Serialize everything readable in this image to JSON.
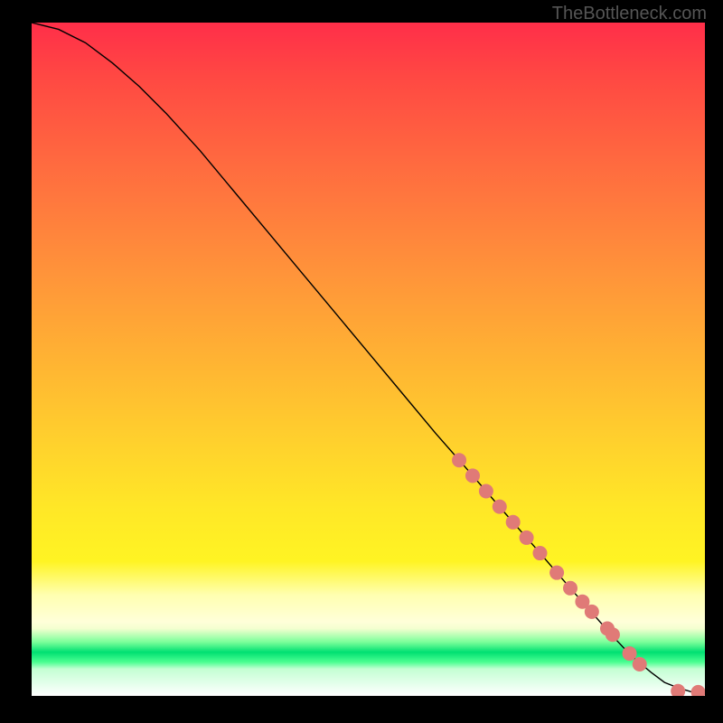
{
  "watermark": "TheBottleneck.com",
  "chart_data": {
    "type": "line",
    "title": "",
    "xlabel": "",
    "ylabel": "",
    "xlim": [
      0,
      100
    ],
    "ylim": [
      0,
      100
    ],
    "curve": {
      "name": "curve",
      "x": [
        0,
        4,
        8,
        12,
        16,
        20,
        25,
        30,
        35,
        40,
        45,
        50,
        55,
        60,
        65,
        70,
        75,
        80,
        83,
        86,
        89,
        92,
        94,
        96,
        98,
        99.2
      ],
      "y": [
        100,
        99,
        97,
        94,
        90.5,
        86.5,
        81,
        75,
        69,
        63,
        57,
        51,
        45,
        39,
        33.3,
        27.5,
        21.8,
        16,
        12.6,
        9.2,
        6.0,
        3.5,
        2.0,
        1.2,
        0.6,
        0.55
      ]
    },
    "points": {
      "name": "markers",
      "color": "#e07a77",
      "x": [
        63.5,
        65.5,
        67.5,
        69.5,
        71.5,
        73.5,
        75.5,
        78.0,
        80.0,
        81.8,
        83.2,
        85.5,
        86.3,
        88.8,
        90.3,
        96.0,
        99.0
      ],
      "y": [
        35.0,
        32.7,
        30.4,
        28.1,
        25.8,
        23.5,
        21.2,
        18.3,
        16.0,
        14.0,
        12.5,
        10.0,
        9.1,
        6.3,
        4.7,
        0.7,
        0.55
      ]
    }
  }
}
